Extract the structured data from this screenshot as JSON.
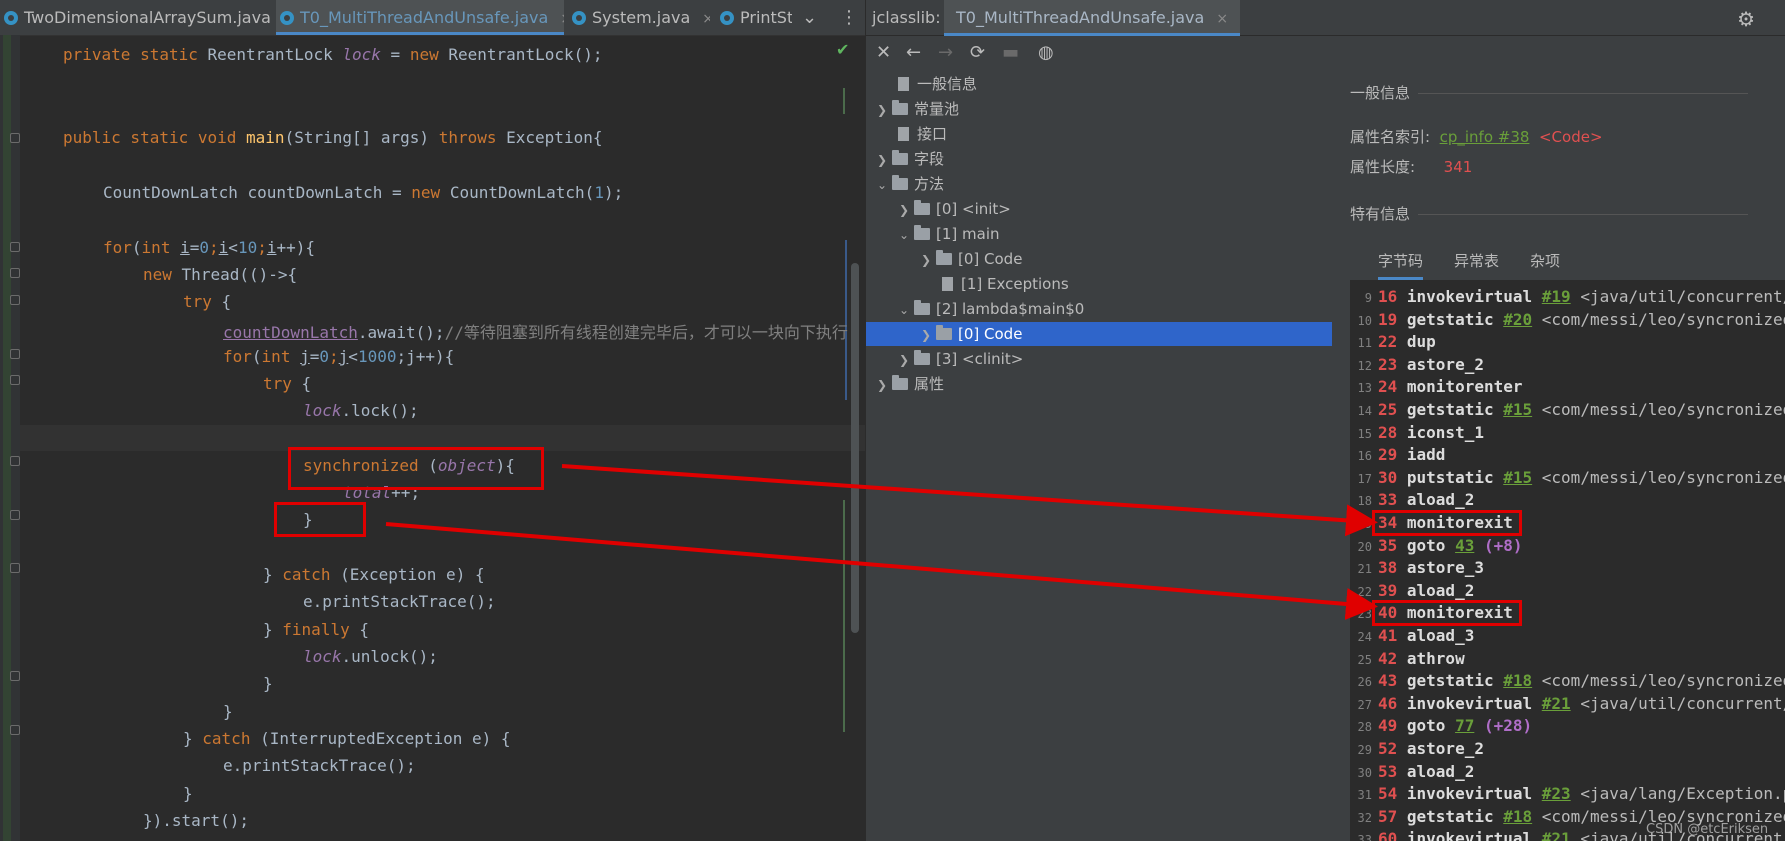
{
  "editor": {
    "tabs": [
      {
        "label": "TwoDimensionalArraySum.java",
        "close": "×"
      },
      {
        "label": "T0_MultiThreadAndUnsafe.java",
        "close": "×"
      },
      {
        "label": "System.java",
        "close": "×"
      },
      {
        "label": "PrintSt"
      }
    ],
    "more_icon": "⋮",
    "chevron": "⌄",
    "check": "✔",
    "lines": {
      "l1_kw": "private static",
      "l1_type": "ReentrantLock",
      "l1_var": "lock",
      "l1_eq": "=",
      "l1_new": "new",
      "l1_rest": "ReentrantLock();",
      "l2_kw1": "public static void",
      "l2_fn": "main",
      "l2_args": "(String[] args)",
      "l2_throws": "throws",
      "l2_rest": "Exception{",
      "l3_a": "CountDownLatch countDownLatch =",
      "l3_new": "new",
      "l3_b": "CountDownLatch(",
      "l3_num": "1",
      "l3_c": ");",
      "l4_for": "for",
      "l4_int": "int",
      "l4_i": "i",
      "l4_eq": "=",
      "l4_n0": "0",
      "l4_semi": ";",
      "l4_i2": "i",
      "l4_lt": "<",
      "l4_n10": "10",
      "l4_i3": "i",
      "l4_end": "++){",
      "l5_new": "new",
      "l5_rest": "Thread(()->{",
      "l6_try": "try",
      "l6_brace": "{",
      "l7_var": "countDownLatch",
      "l7_call": ".await();",
      "l7_cm": "//等待阻塞到所有线程创建完毕后，才可以一块向下执行",
      "l8_for": "for",
      "l8_int": "int",
      "l8_j": "j",
      "l8_eq": "=",
      "l8_n0": "0",
      "l8_semi": ";",
      "l8_j2": "j",
      "l8_lt": "<",
      "l8_n1000": "1000",
      "l8_rest": ";j++){",
      "l9_try": "try",
      "l9_brace": "{",
      "l10_var": "lock",
      "l10_call": ".lock();",
      "l11_sync": "synchronized",
      "l11_p1": "(",
      "l11_obj": "object",
      "l11_p2": "){",
      "l12_var": "total",
      "l12_op": "++;",
      "l13": "}",
      "l14_close": "}",
      "l14_catch": "catch",
      "l14_rest": "(Exception e) {",
      "l15": "e.printStackTrace();",
      "l16_close": "}",
      "l16_finally": "finally",
      "l16_brace": "{",
      "l17_var": "lock",
      "l17_call": ".unlock();",
      "l18": "}",
      "l19": "}",
      "l20_close": "}",
      "l20_catch": "catch",
      "l20_rest": "(InterruptedException e) {",
      "l21": "e.printStackTrace();",
      "l22": "}",
      "l23": "}).start();"
    }
  },
  "jclasslib": {
    "tab_label": "jclasslib:",
    "file_tab": "T0_MultiThreadAndUnsafe.java",
    "file_close": "×",
    "gear": "⚙",
    "toolbar": {
      "close": "✕",
      "back": "←",
      "forward": "→",
      "refresh": "⟳",
      "save": "▬",
      "web": "◍"
    },
    "tree": [
      {
        "label": "一般信息"
      },
      {
        "label": "常量池"
      },
      {
        "label": "接口"
      },
      {
        "label": "字段"
      },
      {
        "label": "方法"
      },
      {
        "label": "[0] <init>"
      },
      {
        "label": "[1] main"
      },
      {
        "label": "[0] Code"
      },
      {
        "label": "[1] Exceptions"
      },
      {
        "label": "[2] lambda$main$0"
      },
      {
        "label": "[0] Code"
      },
      {
        "label": "[3] <clinit>"
      },
      {
        "label": "属性"
      }
    ],
    "general": {
      "heading": "一般信息",
      "attr_name_label": "属性名索引:",
      "attr_name_link": "cp_info #38",
      "attr_name_value": "<Code>",
      "attr_len_label": "属性长度:",
      "attr_len_value": "341",
      "specific_heading": "特有信息"
    },
    "subtabs": [
      "字节码",
      "异常表",
      "杂项"
    ],
    "bytecode": [
      {
        "ln": "9",
        "off": "16",
        "ins": "invokevirtual",
        "ref": "#19",
        "desc": "<java/util/concurrent/"
      },
      {
        "ln": "10",
        "off": "19",
        "ins": "getstatic",
        "ref": "#20",
        "desc": "<com/messi/leo/syncronized"
      },
      {
        "ln": "11",
        "off": "22",
        "ins": "dup"
      },
      {
        "ln": "12",
        "off": "23",
        "ins": "astore_2"
      },
      {
        "ln": "13",
        "off": "24",
        "ins": "monitorenter"
      },
      {
        "ln": "14",
        "off": "25",
        "ins": "getstatic",
        "ref": "#15",
        "desc": "<com/messi/leo/syncronized"
      },
      {
        "ln": "15",
        "off": "28",
        "ins": "iconst_1"
      },
      {
        "ln": "16",
        "off": "29",
        "ins": "iadd"
      },
      {
        "ln": "17",
        "off": "30",
        "ins": "putstatic",
        "ref": "#15",
        "desc": "<com/messi/leo/syncronized"
      },
      {
        "ln": "18",
        "off": "33",
        "ins": "aload_2"
      },
      {
        "ln": "19",
        "off": "34",
        "ins": "monitorexit"
      },
      {
        "ln": "20",
        "off": "35",
        "ins": "goto",
        "ref": "43",
        "rel": "(+8)"
      },
      {
        "ln": "21",
        "off": "38",
        "ins": "astore_3"
      },
      {
        "ln": "22",
        "off": "39",
        "ins": "aload_2"
      },
      {
        "ln": "23",
        "off": "40",
        "ins": "monitorexit"
      },
      {
        "ln": "24",
        "off": "41",
        "ins": "aload_3"
      },
      {
        "ln": "25",
        "off": "42",
        "ins": "athrow"
      },
      {
        "ln": "26",
        "off": "43",
        "ins": "getstatic",
        "ref": "#18",
        "desc": "<com/messi/leo/syncronized"
      },
      {
        "ln": "27",
        "off": "46",
        "ins": "invokevirtual",
        "ref": "#21",
        "desc": "<java/util/concurrent/"
      },
      {
        "ln": "28",
        "off": "49",
        "ins": "goto",
        "ref": "77",
        "rel": "(+28)"
      },
      {
        "ln": "29",
        "off": "52",
        "ins": "astore_2"
      },
      {
        "ln": "30",
        "off": "53",
        "ins": "aload_2"
      },
      {
        "ln": "31",
        "off": "54",
        "ins": "invokevirtual",
        "ref": "#23",
        "desc": "<java/lang/Exception.p"
      },
      {
        "ln": "32",
        "off": "57",
        "ins": "getstatic",
        "ref": "#18",
        "desc": "<com/messi/leo/syncronized"
      },
      {
        "ln": "33",
        "off": "60",
        "ins": "invokevirtual",
        "ref": "#21",
        "desc": "<java/util/concurrent/"
      }
    ]
  },
  "watermark": "CSDN @etcEriksen",
  "colors": {
    "highlight_box": "#e00000",
    "selection": "#2f65ca",
    "keyword": "#cc7832",
    "offset": "#e05050"
  }
}
